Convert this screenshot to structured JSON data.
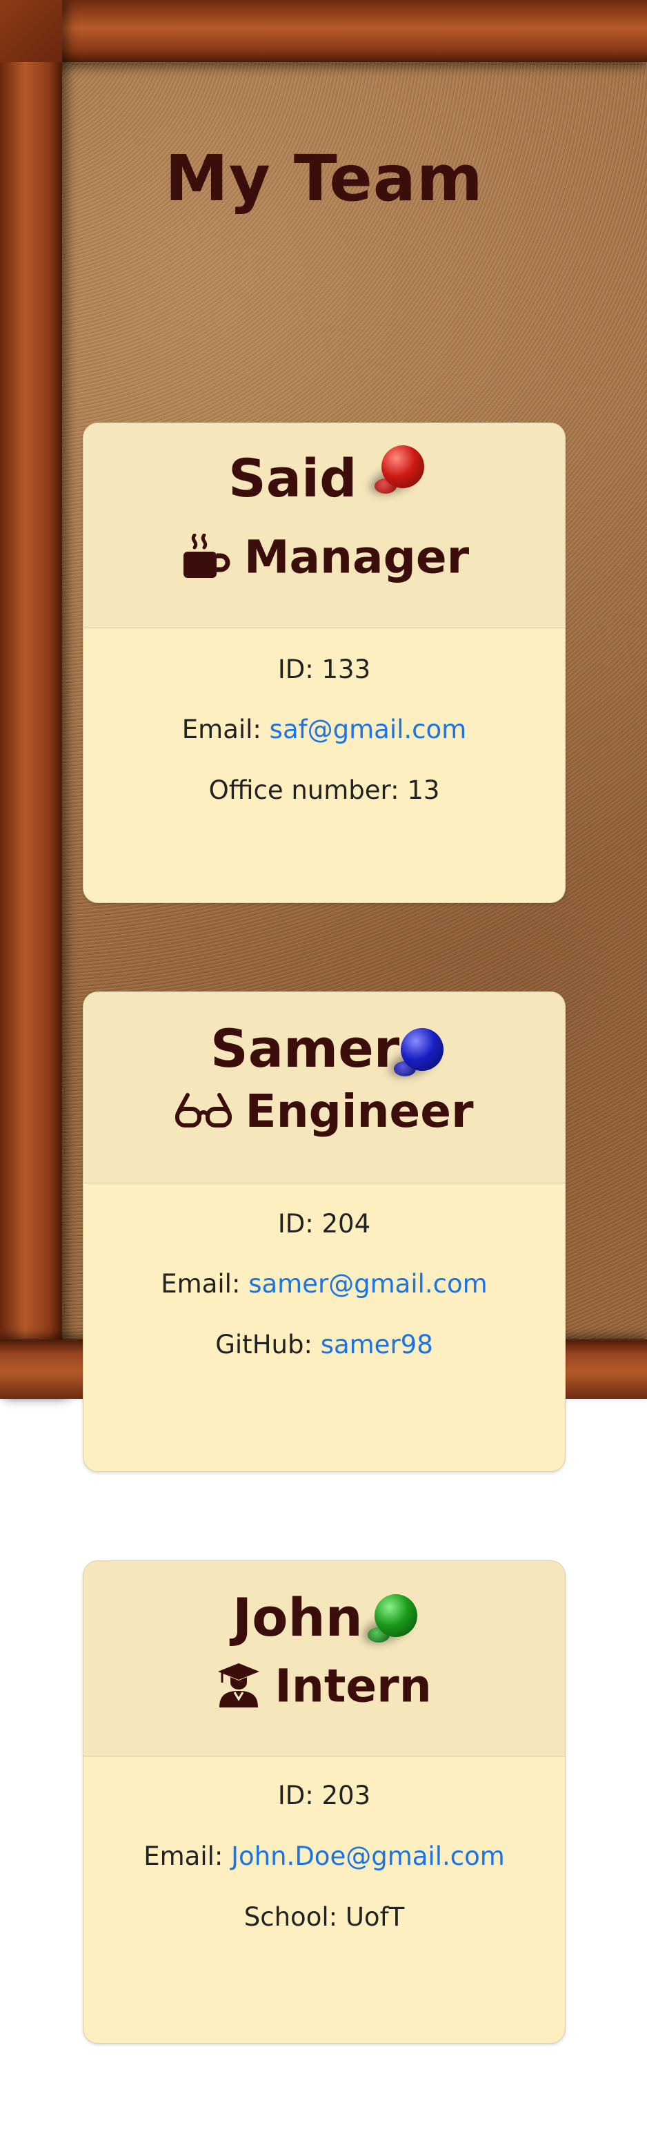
{
  "page": {
    "title": "My Team"
  },
  "cards": [
    {
      "name": "Said",
      "role": "Manager",
      "role_icon": "coffee-mug-icon",
      "pin_color": "#cc1a14",
      "id_label": "ID: 133",
      "email_prefix": "Email: ",
      "email": "saf@gmail.com",
      "extra_prefix": "Office number: ",
      "extra_value": "13"
    },
    {
      "name": "Samer",
      "role": "Engineer",
      "role_icon": "glasses-icon",
      "pin_color": "#1a1fc2",
      "id_label": "ID: 204",
      "email_prefix": "Email: ",
      "email": "samer@gmail.com",
      "extra_prefix": "GitHub: ",
      "extra_value": "samer98"
    },
    {
      "name": "John",
      "role": "Intern",
      "role_icon": "graduation-cap-icon",
      "pin_color": "#1a9a1a",
      "id_label": "ID: 203",
      "email_prefix": "Email: ",
      "email": "John.Doe@gmail.com",
      "extra_prefix": "School: ",
      "extra_value": "UofT"
    }
  ]
}
